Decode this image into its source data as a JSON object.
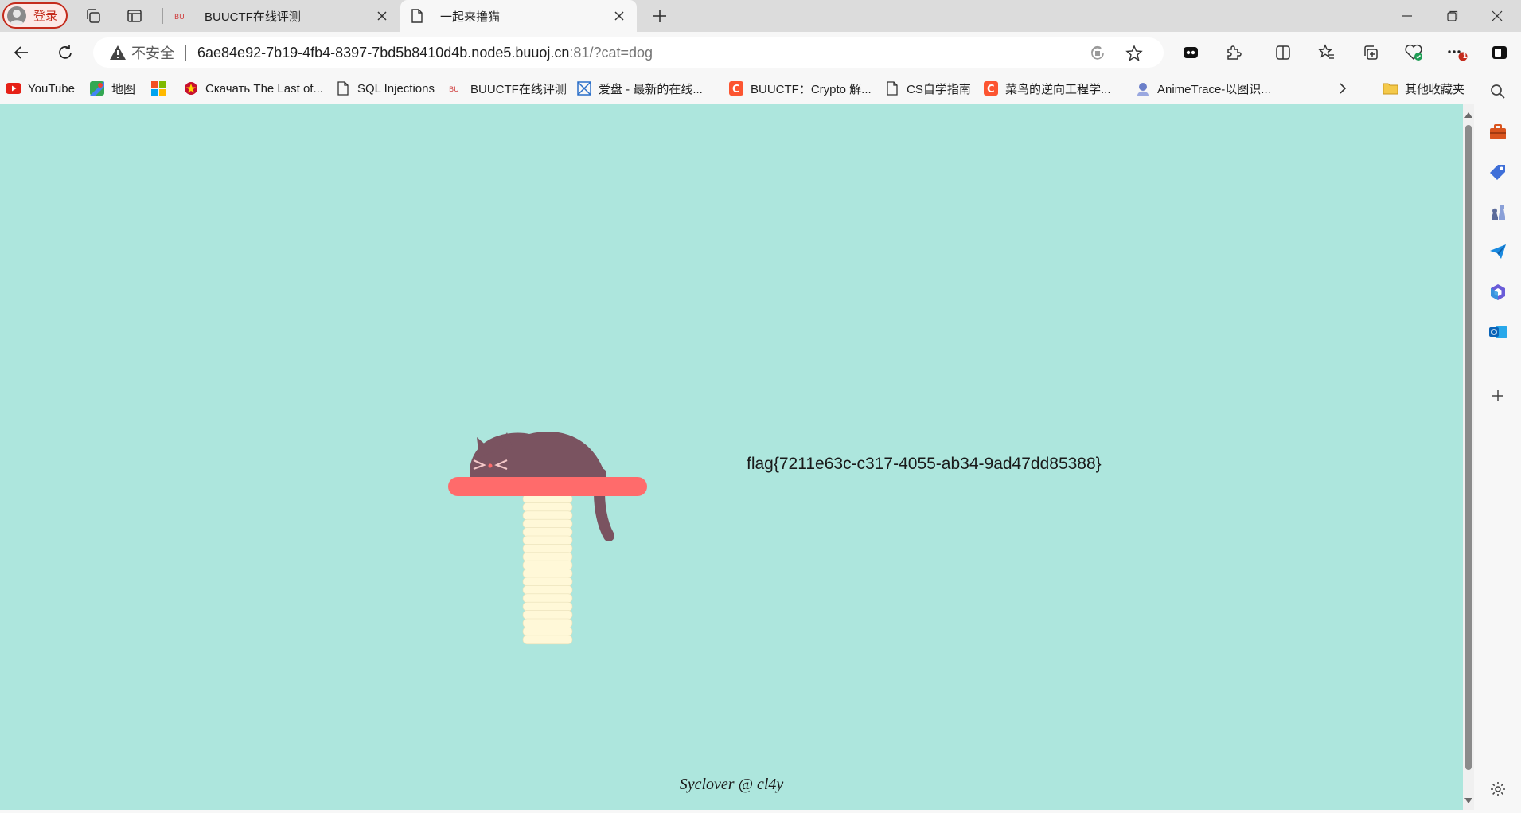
{
  "window": {
    "profile_label": "登录"
  },
  "tabs": [
    {
      "title": "BUUCTF在线评测",
      "favicon": "buuctf-icon",
      "active": false
    },
    {
      "title": "一起来撸猫",
      "favicon": "page-icon",
      "active": true
    }
  ],
  "toolbar": {
    "insecure_label": "不安全",
    "url_host": "6ae84e92-7b19-4fb4-8397-7bd5b8410d4b.node5.buuoj.cn",
    "url_rest": ":81/?cat=dog",
    "notification_badge": "1"
  },
  "bookmarks": [
    {
      "label": "YouTube",
      "icon": "youtube-icon"
    },
    {
      "label": "地图",
      "icon": "maps-icon"
    },
    {
      "label": "",
      "icon": "microsoft-icon"
    },
    {
      "label": "Скачать The Last of...",
      "icon": "emblem-icon"
    },
    {
      "label": "SQL Injections",
      "icon": "page-icon"
    },
    {
      "label": "BUUCTF在线评测",
      "icon": "buuctf-icon"
    },
    {
      "label": "爱盘 - 最新的在线...",
      "icon": "aipan-icon"
    },
    {
      "label": "BUUCTF：Crypto 解...",
      "icon": "csdn-icon"
    },
    {
      "label": "CS自学指南",
      "icon": "page-icon"
    },
    {
      "label": "菜鸟的逆向工程学...",
      "icon": "csdn-icon"
    },
    {
      "label": "AnimeTrace-以图识...",
      "icon": "anime-icon"
    }
  ],
  "other_bookmarks_label": "其他收藏夹",
  "page": {
    "flag": "flag{7211e63c-c317-4055-ab34-9ad47dd85388}",
    "credit": "Syclover @ cl4y"
  },
  "colors": {
    "page_bg": "#ade6dd",
    "cat": "#7a5360",
    "perch": "#ff6b6b",
    "post": "#fff8d8",
    "accent_red": "#c42b1c"
  }
}
